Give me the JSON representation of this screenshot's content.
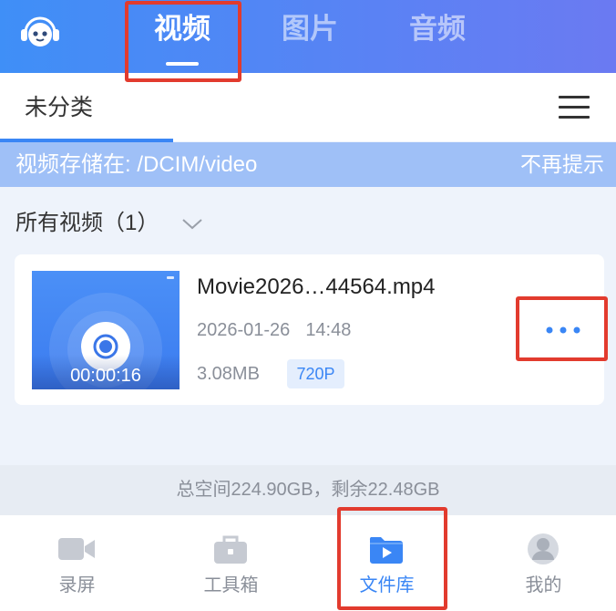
{
  "header": {
    "logo_icon": "headset-face-logo-icon",
    "tabs": [
      {
        "label": "视频",
        "active": true
      },
      {
        "label": "图片",
        "active": false
      },
      {
        "label": "音频",
        "active": false
      }
    ]
  },
  "category_bar": {
    "current": "未分类",
    "menu_icon": "hamburger-menu-icon"
  },
  "storage_notice": {
    "text": "视频存储在: /DCIM/video",
    "dismiss_label": "不再提示"
  },
  "video_list": {
    "heading": "所有视频（1）",
    "expand_icon": "chevron-down-icon",
    "items": [
      {
        "title": "Movie2026…44564.mp4",
        "date": "2026-01-26",
        "time": "14:48",
        "size": "3.08MB",
        "resolution": "720P",
        "duration": "00:00:16",
        "more_icon": "more-dots-icon"
      }
    ]
  },
  "storage_summary": "总空间224.90GB，剩余22.48GB",
  "bottom_nav": {
    "items": [
      {
        "label": "录屏",
        "icon": "video-camera-icon",
        "active": false
      },
      {
        "label": "工具箱",
        "icon": "toolbox-icon",
        "active": false
      },
      {
        "label": "文件库",
        "icon": "folder-play-icon",
        "active": true
      },
      {
        "label": "我的",
        "icon": "avatar-icon",
        "active": false
      }
    ]
  },
  "colors": {
    "header_start": "#3f8ff7",
    "header_end": "#6b7af2",
    "accent": "#3a86f5",
    "banner_bg": "#9fc0f7",
    "content_bg": "#eef3fb",
    "storage_bg": "#e7ecf3",
    "badge_bg": "#e4eefd",
    "muted": "#8a8f99",
    "highlight": "#e23b2e"
  }
}
